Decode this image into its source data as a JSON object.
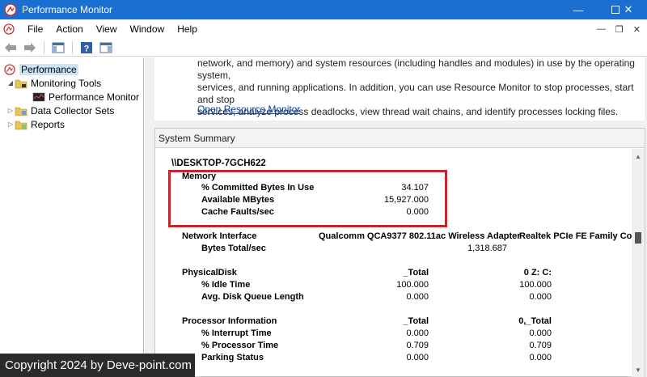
{
  "window": {
    "title": "Performance Monitor"
  },
  "menu": [
    "File",
    "Action",
    "View",
    "Window",
    "Help"
  ],
  "tree": {
    "root": "Performance",
    "monitoring_tools": "Monitoring Tools",
    "performance_monitor": "Performance Monitor",
    "data_collector_sets": "Data Collector Sets",
    "reports": "Reports"
  },
  "description": {
    "line1": "network, and memory) and system resources (including handles and modules) in use by the operating system,",
    "line2": "services, and running applications. In addition, you can use Resource Monitor to stop processes, start and stop",
    "line3": "services, analyze process deadlocks, view thread wait chains, and identify processes locking files.",
    "link": "Open Resource Monitor"
  },
  "summary": {
    "header": "System Summary",
    "computer": "\\\\DESKTOP-7GCH622",
    "memory": {
      "label": "Memory",
      "rows": [
        {
          "name": "% Committed Bytes In Use",
          "value": "34.107"
        },
        {
          "name": "Available MBytes",
          "value": "15,927.000"
        },
        {
          "name": "Cache Faults/sec",
          "value": "0.000"
        }
      ]
    },
    "network": {
      "label": "Network Interface",
      "col1": "Qualcomm QCA9377 802.11ac Wireless Adapter",
      "col2": "Realtek PCIe FE Family Con",
      "row_name": "Bytes Total/sec",
      "row_value": "1,318.687"
    },
    "disk": {
      "label": "PhysicalDisk",
      "col1": "_Total",
      "col2": "0 Z: C:",
      "rows": [
        {
          "name": "% Idle Time",
          "v1": "100.000",
          "v2": "100.000"
        },
        {
          "name": "Avg. Disk Queue Length",
          "v1": "0.000",
          "v2": "0.000"
        }
      ]
    },
    "processor": {
      "label": "Processor Information",
      "col1": "_Total",
      "col2": "0,_Total",
      "rows": [
        {
          "name": "% Interrupt Time",
          "v1": "0.000",
          "v2": "0.000"
        },
        {
          "name": "% Processor Time",
          "v1": "0.709",
          "v2": "0.709"
        },
        {
          "name": "Parking Status",
          "v1": "0.000",
          "v2": "0.000"
        }
      ]
    }
  },
  "watermark": "Copyright 2024 by Deve-point.com",
  "colors": {
    "titlebar": "#1a6fd0",
    "highlight": "#d2202a",
    "link": "#0645ad"
  }
}
